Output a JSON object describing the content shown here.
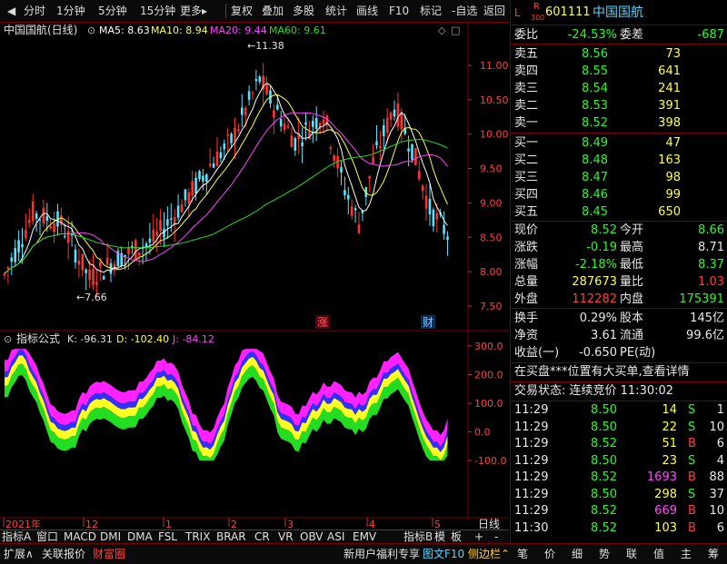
{
  "toolbar": {
    "left": [
      "分时",
      "1分钟",
      "5分钟",
      "15分钟",
      "更多"
    ],
    "right": [
      "复权",
      "叠加",
      "多股",
      "统计",
      "画线",
      "F10",
      "标记",
      "-自选",
      "返回"
    ]
  },
  "main_chart": {
    "title": "中国国航(日线)",
    "ma5_label": "MA5: 8.63",
    "ma10_label": "MA10: 8.94",
    "ma20_label": "MA20: 9.44",
    "ma60_label": "MA60: 9.61",
    "high_marker": "11.38",
    "low_marker": "7.66",
    "badge_zhang": "涨",
    "badge_cai": "财",
    "price_ticks": [
      "11.00",
      "10.50",
      "10.00",
      "9.50",
      "9.00",
      "8.50",
      "8.00",
      "7.50"
    ],
    "colors": {
      "up": "#ff3232",
      "down": "#54e4ff",
      "ma5": "#ffffff",
      "ma10": "#ffff44",
      "ma20": "#ff44ff",
      "ma60": "#22dd22"
    }
  },
  "indicator": {
    "title": "指标公式",
    "k_label": "K: -96.31",
    "d_label": "D: -102.40",
    "j_label": "J: -84.12",
    "ticks": [
      "300.0",
      "200.0",
      "100.0",
      "0.0",
      "-100.0"
    ]
  },
  "time_axis": {
    "labels": [
      "2021年",
      "12",
      "1",
      "2",
      "3",
      "4",
      "5"
    ],
    "right_label": "日线"
  },
  "tabs": {
    "items": [
      "指标A",
      "窗口",
      "MACD",
      "DMI",
      "DMA",
      "FSL",
      "TRIX",
      "BRAR",
      "CR",
      "VR",
      "OBV",
      "ASI",
      "EMV"
    ],
    "right_items": [
      "指标B",
      "模",
      "板",
      "+",
      "-"
    ]
  },
  "stock": {
    "code": "601111",
    "name": "中国国航",
    "badge_l": "L",
    "badge_r": "R",
    "badge_300": "300"
  },
  "ratio": {
    "wei_bi_label": "委比",
    "wei_bi": "-24.53%",
    "wei_cha_label": "委差",
    "wei_cha": "-687"
  },
  "asks": [
    {
      "label": "卖五",
      "price": "8.56",
      "vol": "73"
    },
    {
      "label": "卖四",
      "price": "8.55",
      "vol": "641"
    },
    {
      "label": "卖三",
      "price": "8.54",
      "vol": "241"
    },
    {
      "label": "卖二",
      "price": "8.53",
      "vol": "391"
    },
    {
      "label": "卖一",
      "price": "8.52",
      "vol": "398"
    }
  ],
  "bids": [
    {
      "label": "买一",
      "price": "8.49",
      "vol": "47"
    },
    {
      "label": "买二",
      "price": "8.48",
      "vol": "163"
    },
    {
      "label": "买三",
      "price": "8.47",
      "vol": "98"
    },
    {
      "label": "买四",
      "price": "8.46",
      "vol": "99"
    },
    {
      "label": "买五",
      "price": "8.45",
      "vol": "650"
    }
  ],
  "quote": [
    {
      "l1": "现价",
      "v1": "8.52",
      "c1": "green",
      "l2": "今开",
      "v2": "8.66",
      "c2": "green"
    },
    {
      "l1": "涨跌",
      "v1": "-0.19",
      "c1": "green",
      "l2": "最高",
      "v2": "8.71",
      "c2": "white"
    },
    {
      "l1": "涨幅",
      "v1": "-2.18%",
      "c1": "green",
      "l2": "最低",
      "v2": "8.37",
      "c2": "green"
    },
    {
      "l1": "总量",
      "v1": "287673",
      "c1": "yellow",
      "l2": "量比",
      "v2": "1.03",
      "c2": "red"
    },
    {
      "l1": "外盘",
      "v1": "112282",
      "c1": "red",
      "l2": "内盘",
      "v2": "175391",
      "c2": "green"
    }
  ],
  "fundamentals": [
    {
      "l1": "换手",
      "v1": "0.29%",
      "l2": "股本",
      "v2": "145亿"
    },
    {
      "l1": "净资",
      "v1": "3.61",
      "l2": "流通",
      "v2": "99.6亿"
    },
    {
      "l1": "收益(一)",
      "v1": "-0.650",
      "l2": "PE(动)",
      "v2": ""
    }
  ],
  "notice": "在买盘***位置有大买单,查看详情",
  "trade_status": "交易状态: 连续竞价 11:30:02",
  "ticks": [
    {
      "time": "11:29",
      "price": "8.50",
      "vol": "14",
      "side": "S",
      "n": "1",
      "vc": "yellow",
      "sc": "green"
    },
    {
      "time": "11:29",
      "price": "8.50",
      "vol": "22",
      "side": "S",
      "n": "10",
      "vc": "yellow",
      "sc": "green"
    },
    {
      "time": "11:29",
      "price": "8.52",
      "vol": "51",
      "side": "B",
      "n": "6",
      "vc": "yellow",
      "sc": "red"
    },
    {
      "time": "11:29",
      "price": "8.50",
      "vol": "23",
      "side": "S",
      "n": "4",
      "vc": "yellow",
      "sc": "green"
    },
    {
      "time": "11:29",
      "price": "8.52",
      "vol": "1693",
      "side": "B",
      "n": "88",
      "vc": "magenta",
      "sc": "red"
    },
    {
      "time": "11:29",
      "price": "8.50",
      "vol": "298",
      "side": "S",
      "n": "37",
      "vc": "yellow",
      "sc": "green"
    },
    {
      "time": "11:29",
      "price": "8.52",
      "vol": "669",
      "side": "B",
      "n": "10",
      "vc": "magenta",
      "sc": "red"
    },
    {
      "time": "11:30",
      "price": "8.52",
      "vol": "103",
      "side": "B",
      "n": "6",
      "vc": "yellow",
      "sc": "red"
    }
  ],
  "bottom_left": [
    "扩展∧",
    "关联报价",
    "财富圈"
  ],
  "bottom_mid": [
    "新用户福利专享",
    "图文F10",
    "侧边栏"
  ],
  "bottom_right": [
    "笔",
    "价",
    "细",
    "势",
    "联",
    "值",
    "主",
    "筹"
  ]
}
